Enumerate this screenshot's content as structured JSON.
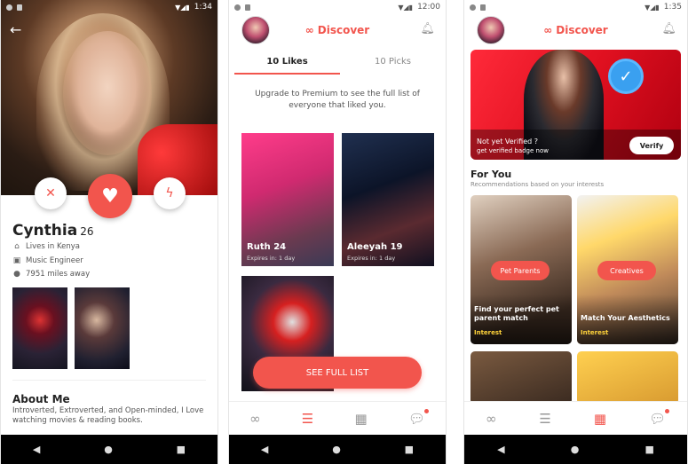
{
  "colors": {
    "accent": "#f2554d",
    "interest_tag": "#ffd33a",
    "verify_badge": "#3aa0f0"
  },
  "status": {
    "p1_time": "1:34",
    "p2_time": "12:00",
    "p3_time": "1:35"
  },
  "profile": {
    "name": "Cynthia",
    "age": "26",
    "location": "Lives in Kenya",
    "job": "Music Engineer",
    "distance": "7951 miles away",
    "about_title": "About Me",
    "about_text": "Introverted, Extroverted, and Open-minded, I Love watching movies & reading books."
  },
  "header": {
    "brand": "Discover"
  },
  "likes": {
    "tab_likes": "10 Likes",
    "tab_picks": "10 Picks",
    "upgrade_text": "Upgrade to Premium to see the full list of everyone that liked you.",
    "cards": [
      {
        "name": "Ruth 24",
        "expires": "Expires in: 1 day"
      },
      {
        "name": "Aleeyah 19",
        "expires": "Expires in: 1 day"
      }
    ],
    "see_full_list": "SEE FULL LIST"
  },
  "discover": {
    "banner_line1": "Not yet Verified ?",
    "banner_line2": "get verified badge now",
    "verify_button": "Verify",
    "for_you_title": "For You",
    "for_you_sub": "Recommendations based on your interests",
    "recs": [
      {
        "pill": "Pet Parents",
        "title": "Find your perfect pet parent match",
        "tag": "Interest"
      },
      {
        "pill": "Creatives",
        "title": "Match Your Aesthetics",
        "tag": "Interest"
      }
    ]
  },
  "icons": {
    "heart": "heart-icon",
    "close": "close-icon",
    "bolt": "bolt-icon",
    "back": "back-arrow-icon",
    "bell": "bell-icon",
    "link": "link-icon",
    "list": "list-icon",
    "grid": "grid-search-icon",
    "chat": "chat-icon"
  }
}
